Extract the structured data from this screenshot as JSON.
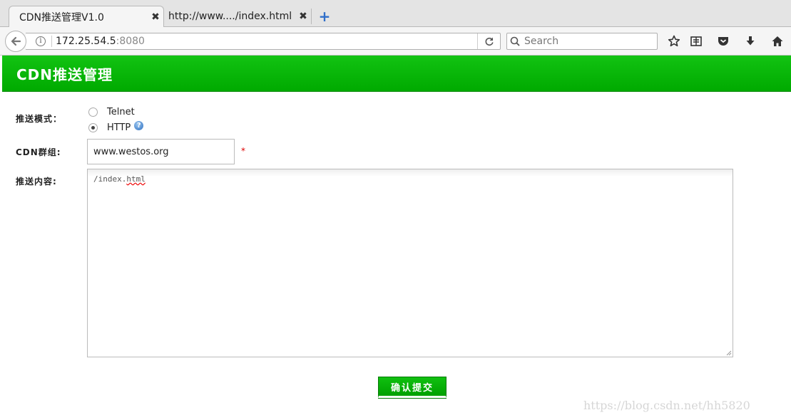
{
  "browser": {
    "tabs": [
      {
        "label": "CDN推送管理V1.0",
        "active": true
      },
      {
        "label": "http://www..../index.html",
        "active": false
      }
    ],
    "close_glyph": "✖",
    "new_tab_glyph": "+",
    "url_host": "172.25.54.5",
    "url_port": ":8080",
    "search_placeholder": "Search",
    "info_glyph": "i",
    "icons": [
      "back-arrow-icon",
      "info-icon",
      "reload-icon",
      "search-icon",
      "bookmark-star-icon",
      "reading-list-icon",
      "pocket-icon",
      "download-icon",
      "home-icon"
    ]
  },
  "page": {
    "title": "CDN推送管理",
    "header_color": "#00aa00",
    "form": {
      "mode_label": "推送模式：",
      "mode_options": [
        {
          "label": "Telnet",
          "checked": false
        },
        {
          "label": "HTTP",
          "checked": true
        }
      ],
      "help_glyph": "?",
      "group_label": "CDN群组:",
      "group_value": "www.westos.org",
      "required_mark": "*",
      "content_label": "推送内容:",
      "content_prefix": "/index.",
      "content_misspelled": "html",
      "submit_label": "确认提交"
    }
  },
  "watermark": "https://blog.csdn.net/hh5820"
}
